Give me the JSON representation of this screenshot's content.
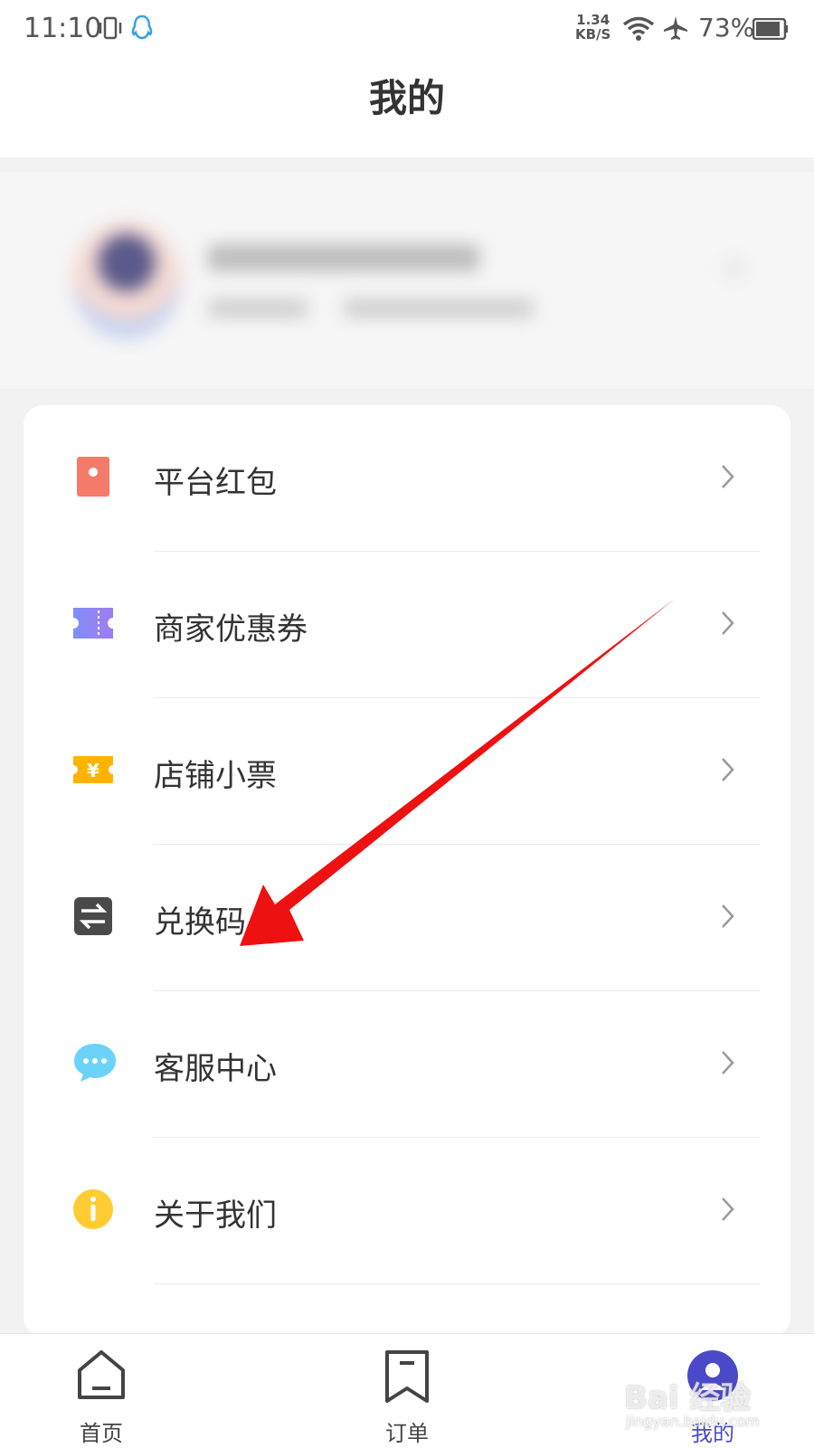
{
  "status_bar": {
    "time": "11:10",
    "speed_value": "1.34",
    "speed_unit": "KB/S",
    "battery": "73%"
  },
  "nav": {
    "title": "我的"
  },
  "menu": {
    "items": [
      {
        "label": "平台红包",
        "icon": "red-envelope-icon",
        "color": "#f47a6a"
      },
      {
        "label": "商家优惠券",
        "icon": "coupon-icon",
        "color": "#8a7ef5"
      },
      {
        "label": "店铺小票",
        "icon": "receipt-icon",
        "color": "#ffb300"
      },
      {
        "label": "兑换码",
        "icon": "exchange-icon",
        "color": "#555555"
      },
      {
        "label": "客服中心",
        "icon": "chat-icon",
        "color": "#5bc8f5"
      },
      {
        "label": "关于我们",
        "icon": "info-icon",
        "color": "#ffcc33"
      }
    ]
  },
  "tabs": [
    {
      "label": "首页",
      "icon": "home-icon"
    },
    {
      "label": "订单",
      "icon": "bookmark-icon"
    },
    {
      "label": "我的",
      "icon": "profile-icon"
    }
  ],
  "colors": {
    "accent": "#4a49c8",
    "annotation_arrow": "#ee1111"
  },
  "watermark": {
    "brand": "Bai 经验",
    "url": "jingyan.baidu.com"
  }
}
